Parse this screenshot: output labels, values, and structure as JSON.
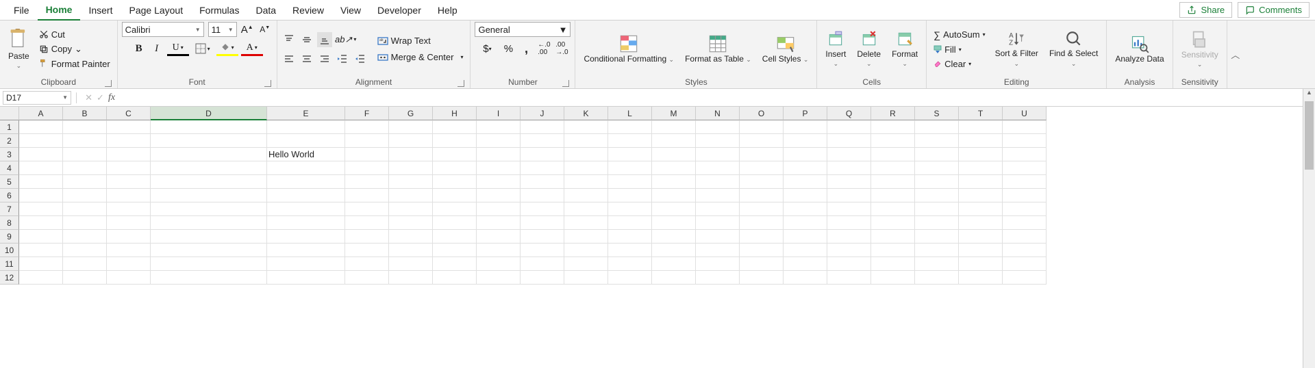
{
  "tabs": [
    "File",
    "Home",
    "Insert",
    "Page Layout",
    "Formulas",
    "Data",
    "Review",
    "View",
    "Developer",
    "Help"
  ],
  "active_tab": "Home",
  "top_right": {
    "share": "Share",
    "comments": "Comments"
  },
  "ribbon": {
    "clipboard": {
      "label": "Clipboard",
      "paste": "Paste",
      "cut": "Cut",
      "copy": "Copy",
      "format_painter": "Format Painter"
    },
    "font": {
      "label": "Font",
      "font_name": "Calibri",
      "font_size": "11"
    },
    "alignment": {
      "label": "Alignment",
      "wrap": "Wrap Text",
      "merge": "Merge & Center"
    },
    "number": {
      "label": "Number",
      "format": "General"
    },
    "styles": {
      "label": "Styles",
      "conditional": "Conditional Formatting",
      "format_table": "Format as Table",
      "cell_styles": "Cell Styles"
    },
    "cells": {
      "label": "Cells",
      "insert": "Insert",
      "delete": "Delete",
      "format": "Format"
    },
    "editing": {
      "label": "Editing",
      "autosum": "AutoSum",
      "fill": "Fill",
      "clear": "Clear",
      "sort": "Sort & Filter",
      "find": "Find & Select"
    },
    "analysis": {
      "label": "Analysis",
      "analyze": "Analyze Data"
    },
    "sensitivity": {
      "label": "Sensitivity",
      "sensitivity": "Sensitivity"
    }
  },
  "name_box": "D17",
  "formula_bar": "",
  "columns": [
    "A",
    "B",
    "C",
    "D",
    "E",
    "F",
    "G",
    "H",
    "I",
    "J",
    "K",
    "L",
    "M",
    "N",
    "O",
    "P",
    "Q",
    "R",
    "S",
    "T",
    "U"
  ],
  "rows": [
    1,
    2,
    3,
    4,
    5,
    6,
    7,
    8,
    9,
    10,
    11,
    12
  ],
  "cells": {
    "E3": "Hello World"
  },
  "selected_col": "D"
}
